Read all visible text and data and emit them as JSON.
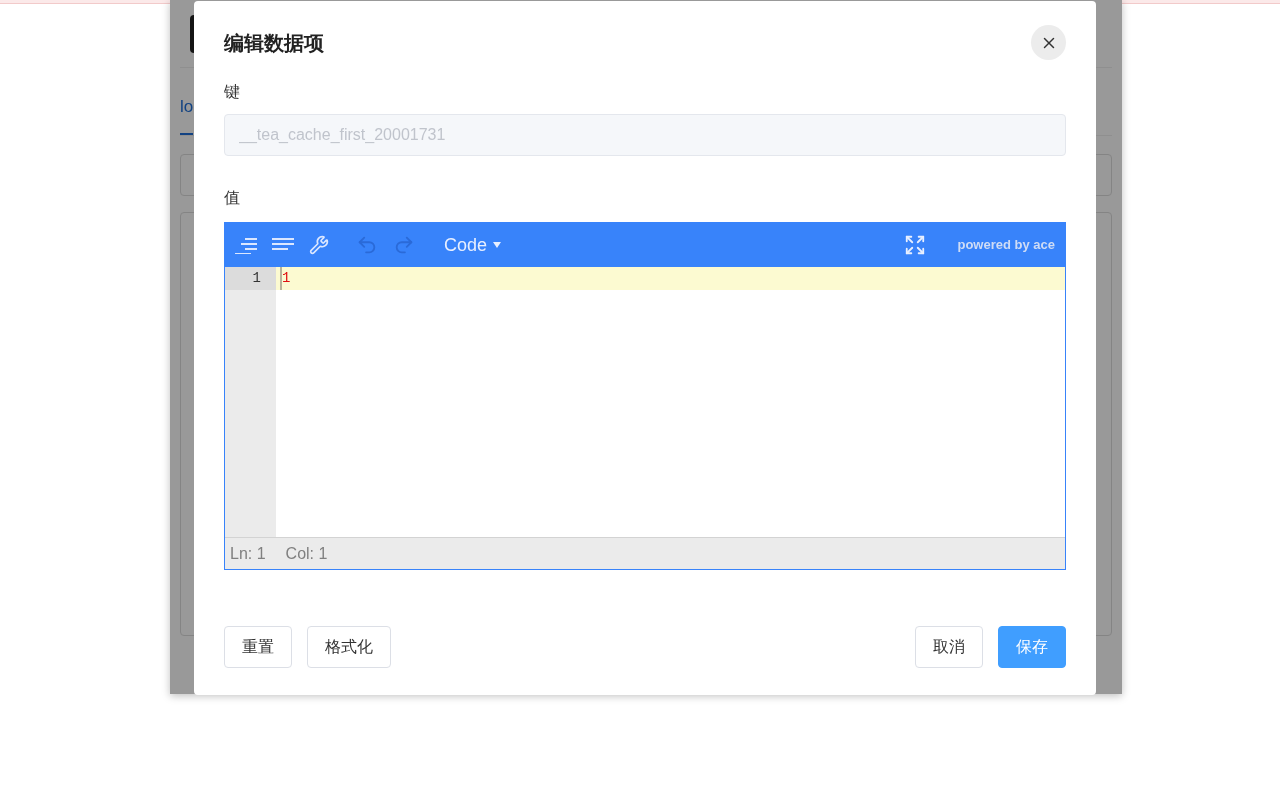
{
  "backdrop": {
    "tab": "lo"
  },
  "dialog": {
    "title": "编辑数据项",
    "key_label": "键",
    "key_field": {
      "value": "__tea_cache_first_20001731",
      "disabled": true
    },
    "value_label": "值",
    "editor": {
      "mode": "Code",
      "brand": "powered by ace",
      "lines": [
        {
          "number": "1",
          "text": "1",
          "active": true
        }
      ],
      "status": {
        "line": "Ln: 1",
        "column": "Col: 1"
      }
    },
    "buttons_left": [
      "重置",
      "格式化"
    ],
    "buttons_right": [
      {
        "label": "取消",
        "kind": "default"
      },
      {
        "label": "保存",
        "kind": "primary"
      }
    ]
  }
}
